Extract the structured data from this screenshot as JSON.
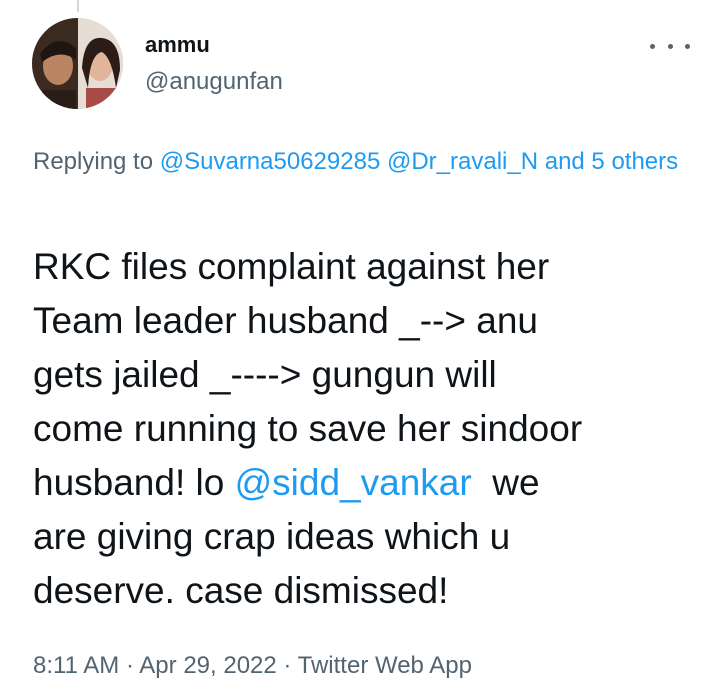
{
  "author": {
    "display_name": "ammu",
    "handle": "@anugunfan"
  },
  "icons": {
    "more": "more-horizontal-icon"
  },
  "reply": {
    "prefix": "Replying to ",
    "mention_1": "@Suvarna50629285",
    "mention_2": "@Dr_ravali_N",
    "others": "and 5 others"
  },
  "tweet": {
    "line_1": "RKC files complaint against her",
    "line_2": "Team leader husband _--> anu",
    "line_3": "gets jailed _----> gungun will",
    "line_4": "come running to save her sindoor",
    "line_5_pre": "husband! lo ",
    "mention": "@sidd_vankar",
    "line_5_post": "  we",
    "line_6": "are giving crap ideas which u",
    "line_7": "deserve. case dismissed!"
  },
  "meta": {
    "time": "8:11 AM",
    "separator": " · ",
    "date": "Apr 29, 2022",
    "source": "Twitter Web App"
  },
  "colors": {
    "link": "#1d9bf0",
    "secondary_text": "#536471",
    "primary_text": "#0f1419"
  }
}
